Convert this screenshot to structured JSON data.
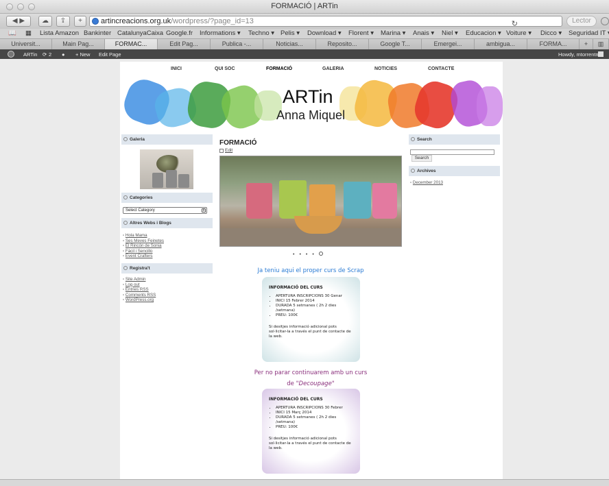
{
  "window": {
    "title": "FORMACIÓ | ARTin"
  },
  "toolbar": {
    "url_host": "artincreacions.org.uk",
    "url_path": "/wordpress/?page_id=13",
    "reader_label": "Lector"
  },
  "bookmarks": [
    "Lista Amazon",
    "Bankinter",
    "CatalunyaCaixa",
    "Google.fr",
    "Informations ▾",
    "Techno ▾",
    "Pelis ▾",
    "Download ▾",
    "Florent ▾",
    "Marina ▾",
    "Anais ▾",
    "Niel ▾",
    "Educacion ▾",
    "Voiture ▾",
    "Dicco ▾",
    "Seguridad IT ▾"
  ],
  "tabs": [
    "Universit...",
    "Main Pag...",
    "FORMAC...",
    "Edit Pag...",
    "Publica -...",
    "Noticias...",
    "Reposito...",
    "Google T...",
    "Emergei...",
    "ambigua...",
    "FORMA..."
  ],
  "adminbar": {
    "site": "ARTin",
    "updates": "2",
    "new_label": "+ New",
    "edit_label": "Edit Page",
    "howdy": "Howdy, mtorrentmi"
  },
  "nav": [
    "INICI",
    "QUI SOC",
    "FORMACIÓ",
    "GALERIA",
    "NOTICIES",
    "CONTACTE"
  ],
  "banner": {
    "title": "ARTin",
    "subtitle": "Anna Miquel"
  },
  "sidebar_left": {
    "galeria_title": "Galeria",
    "categories_title": "Categories",
    "select_label": "Select Category",
    "blogs_title": "Altres Webs i Blogs",
    "blogs": [
      "Hola Mama",
      "Ses Meves Feinetes",
      "El Rincón de Sonia",
      "Fàcil i Sencillo",
      "Event Crafters"
    ],
    "register_title": "Registra't",
    "register_links": [
      "Site Admin",
      "Log out",
      "Entries RSS",
      "Comments RSS",
      "WordPress.org"
    ]
  },
  "content": {
    "title": "FORMACIÓ",
    "edit_label": "Edit",
    "promo1": "Ja teniu aqui el proper curs de Scrap",
    "card1": {
      "heading": "INFORMACIÓ DEL CURS",
      "items": [
        "APERTURA INSCRIPCIONS 30 Genar",
        "INICI 15 Febrer 2014",
        "DURADA 5 setmanes ( 2h 2 dies /setmana)",
        "PREU: 100€"
      ],
      "note": "Si desitjes informació adicional pots sol·licitar-la a través el punt de contacte de la web."
    },
    "promo2_line1": "Per no parar continuarem amb un curs",
    "promo2_pre": "de \"",
    "promo2_italic": "Decoupage",
    "promo2_post": "\"",
    "card2": {
      "heading": "INFORMACIÓ DEL CURS",
      "items": [
        "APERTURA INSCRIPCIONS 30 Febrer",
        "INICI 15 Març 2014",
        "DURADA 5 setmanes ( 2h 2 dies /setmana)",
        "PREU: 100€"
      ],
      "note": "Si desitjes informació adicional pots sol·licitar-la a través el punt de contacte de la web."
    }
  },
  "sidebar_right": {
    "search_title": "Search",
    "search_button": "Search",
    "archives_title": "Archives",
    "archives": [
      "December 2013"
    ]
  }
}
